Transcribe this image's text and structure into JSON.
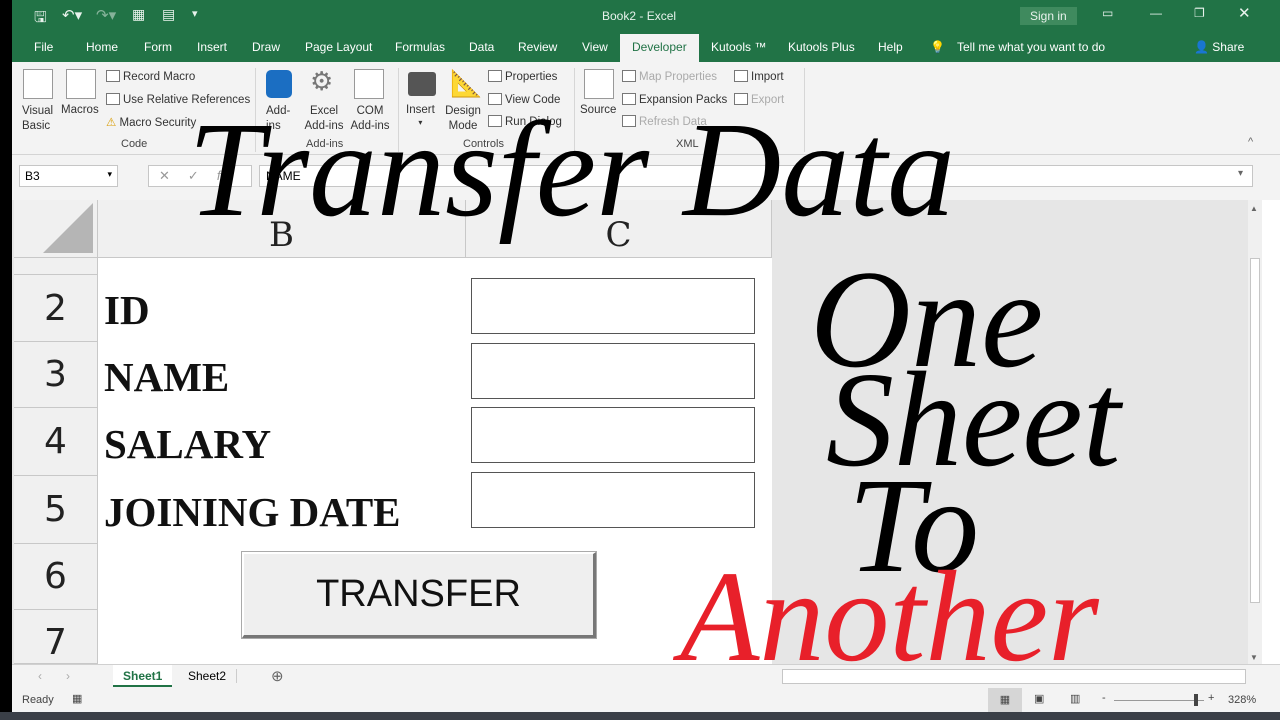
{
  "window": {
    "title": "Book2  -  Excel",
    "sign_in": "Sign in"
  },
  "tabs": [
    "File",
    "Home",
    "Form",
    "Insert",
    "Draw",
    "Page Layout",
    "Formulas",
    "Data",
    "Review",
    "View",
    "Developer",
    "Kutools ™",
    "Kutools Plus",
    "Help"
  ],
  "active_tab": "Developer",
  "tell_me": "Tell me what you want to do",
  "share": "Share",
  "ribbon": {
    "code": {
      "label": "Code",
      "visual_basic": "Visual Basic",
      "macros": "Macros",
      "record_macro": "Record Macro",
      "use_relative": "Use Relative References",
      "macro_security": "Macro Security"
    },
    "addins": {
      "label": "Add-ins",
      "addins": "Add-ins",
      "excel_addins": "Excel Add-ins",
      "com_addins": "COM Add-ins"
    },
    "controls": {
      "label": "Controls",
      "insert": "Insert",
      "design_mode": "Design Mode",
      "properties": "Properties",
      "view_code": "View Code",
      "run_dialog": "Run Dialog"
    },
    "xml": {
      "label": "XML",
      "source": "Source",
      "map_properties": "Map Properties",
      "expansion_packs": "Expansion Packs",
      "refresh_data": "Refresh Data",
      "import": "Import",
      "export": "Export"
    }
  },
  "name_box": "B3",
  "formula": "NAME",
  "columns": [
    "B",
    "C"
  ],
  "rows": [
    "2",
    "3",
    "4",
    "5",
    "6",
    "7"
  ],
  "form": {
    "labels": [
      "ID",
      "NAME",
      "SALARY",
      "JOINING DATE"
    ],
    "values": [
      "",
      "",
      "",
      ""
    ],
    "button": "TRANSFER"
  },
  "overlay": {
    "title": "Transfer Data",
    "line1": "One",
    "line2": "Sheet",
    "line3": "To",
    "line4": "Another",
    "accent": "#e8202a"
  },
  "sheets": [
    "Sheet1",
    "Sheet2"
  ],
  "active_sheet": "Sheet1",
  "status": {
    "ready": "Ready",
    "zoom": "328%"
  }
}
